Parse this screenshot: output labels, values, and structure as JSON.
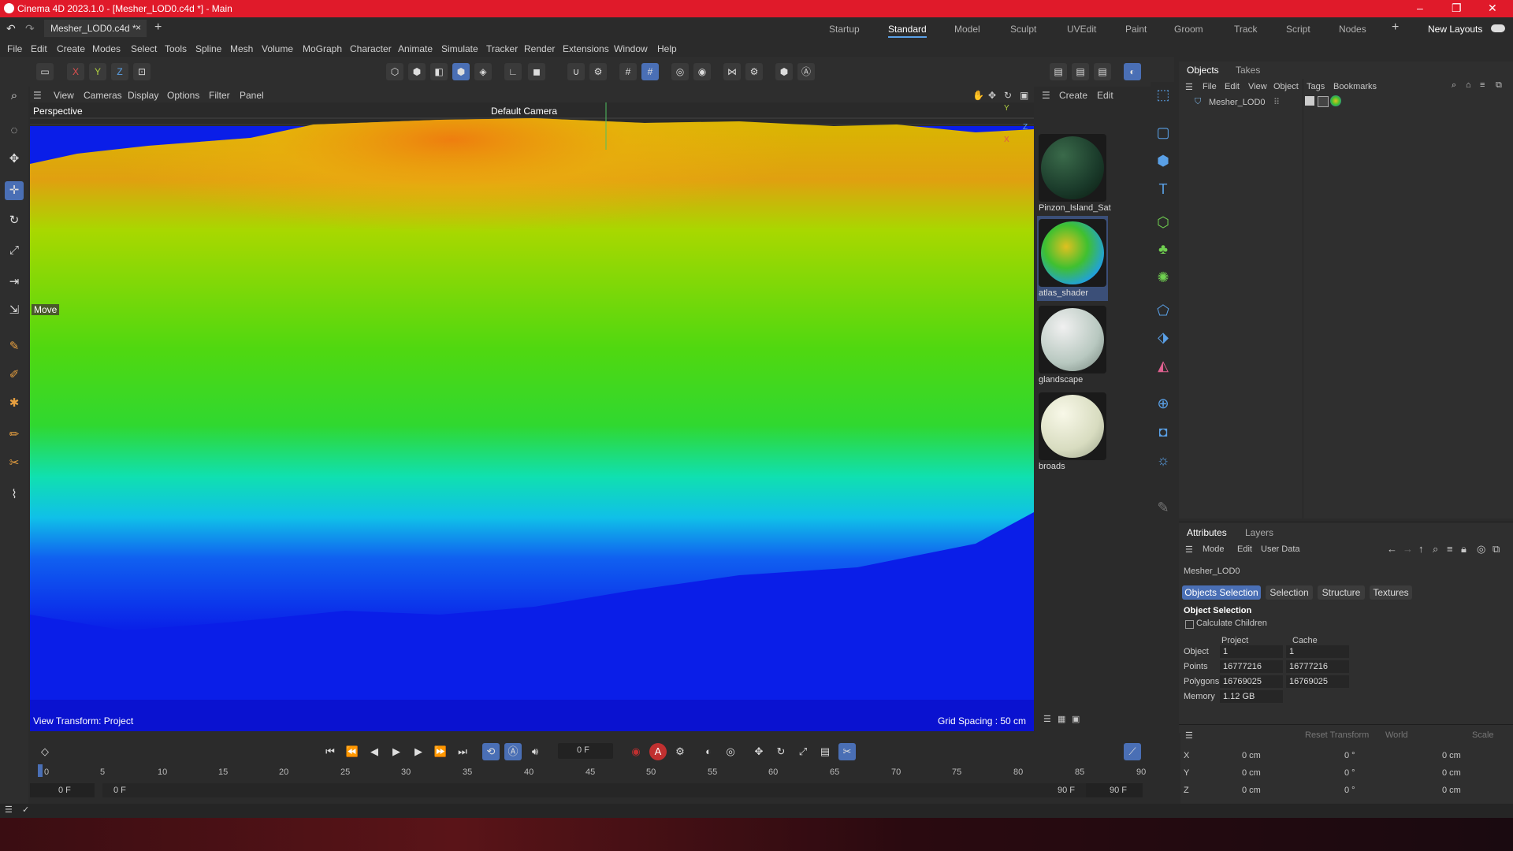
{
  "window": {
    "title": "Cinema 4D 2023.1.0 - [Mesher_LOD0.c4d *] - Main",
    "controls": [
      "–",
      "❐",
      "✕"
    ]
  },
  "tabs": {
    "doc_tab": "Mesher_LOD0.c4d *",
    "layouts": [
      "Startup",
      "Standard",
      "Model",
      "Sculpt",
      "UVEdit",
      "Paint",
      "Groom",
      "Track",
      "Script",
      "Nodes"
    ],
    "active_layout": "Standard",
    "new_layouts": "New Layouts"
  },
  "menu": [
    "File",
    "Edit",
    "Create",
    "Modes",
    "Select",
    "Tools",
    "Spline",
    "Mesh",
    "Volume",
    "MoGraph",
    "Character",
    "Animate",
    "Simulate",
    "Tracker",
    "Render",
    "Extensions",
    "Window",
    "Help"
  ],
  "toolbar": {
    "x": "X",
    "y": "Y",
    "z": "Z"
  },
  "viewport": {
    "menu": [
      "View",
      "Cameras",
      "Display",
      "Options",
      "Filter",
      "Panel"
    ],
    "label": "Perspective",
    "camera": "Default Camera",
    "move_label": "Move",
    "view_transform": "View Transform: Project",
    "grid_spacing": "Grid Spacing : 50 cm",
    "axis_y": "Y",
    "axis_z": "Z",
    "axis_x": "X"
  },
  "materials": {
    "header": [
      "Create",
      "Edit"
    ],
    "items": [
      {
        "name": "Pinzon_Island_Sat",
        "selected": false
      },
      {
        "name": "atlas_shader",
        "selected": true
      },
      {
        "name": "glandscape",
        "selected": false
      },
      {
        "name": "broads",
        "selected": false
      }
    ]
  },
  "objects_panel": {
    "tabs": [
      "Objects",
      "Takes"
    ],
    "menu": [
      "File",
      "Edit",
      "View",
      "Object",
      "Tags",
      "Bookmarks"
    ],
    "objects": [
      {
        "name": "Mesher_LOD0"
      }
    ]
  },
  "attributes": {
    "tabs": [
      "Attributes",
      "Layers"
    ],
    "menu": [
      "Mode",
      "Edit",
      "User Data"
    ],
    "object_name": "Mesher_LOD0",
    "pills": [
      "Objects Selection",
      "Selection",
      "Structure",
      "Textures"
    ],
    "section": "Object Selection",
    "calc_children": "Calculate Children",
    "col_project": "Project",
    "col_cache": "Cache",
    "rows": [
      {
        "label": "Object",
        "project": "1",
        "cache": "1"
      },
      {
        "label": "Points",
        "project": "16777216",
        "cache": "16777216"
      },
      {
        "label": "Polygons",
        "project": "16769025",
        "cache": "16769025"
      },
      {
        "label": "Memory",
        "project": "1.12 GB",
        "cache": ""
      }
    ]
  },
  "coords": {
    "reset": "Reset Transform",
    "space": "World",
    "mode": "Scale",
    "rows": [
      {
        "axis": "X",
        "pos": "0 cm",
        "rot": "0 °",
        "scale": "0 cm"
      },
      {
        "axis": "Y",
        "pos": "0 cm",
        "rot": "0 °",
        "scale": "0 cm"
      },
      {
        "axis": "Z",
        "pos": "0 cm",
        "rot": "0 °",
        "scale": "0 cm"
      }
    ]
  },
  "timeline": {
    "current_frame": "0 F",
    "ticks": [
      "0",
      "5",
      "10",
      "15",
      "20",
      "25",
      "30",
      "35",
      "40",
      "45",
      "50",
      "55",
      "60",
      "65",
      "70",
      "75",
      "80",
      "85",
      "90"
    ],
    "start": "0 F",
    "start2": "0 F",
    "end": "90 F",
    "end2": "90 F"
  }
}
